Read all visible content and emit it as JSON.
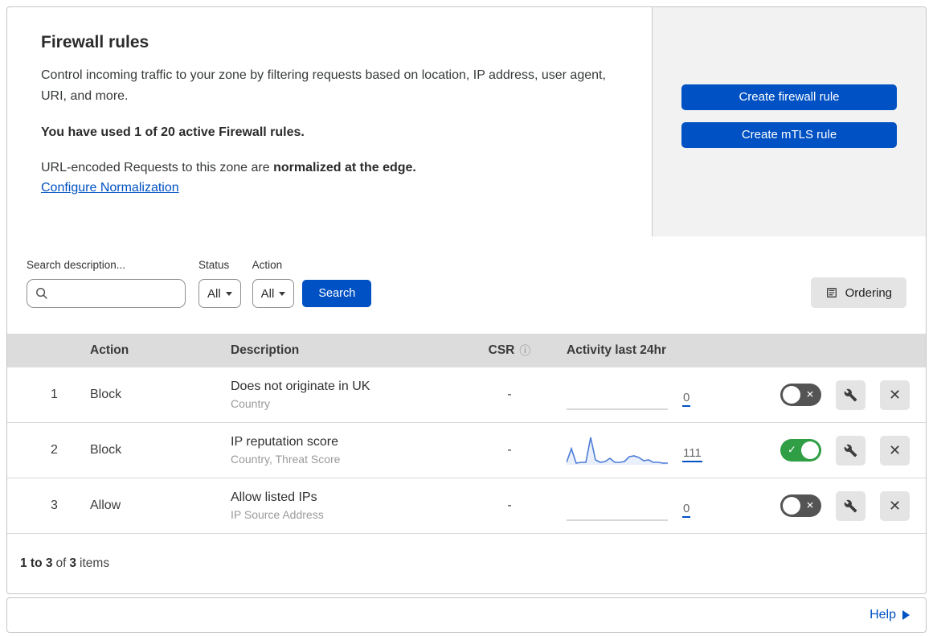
{
  "colors": {
    "primary_blue": "#0051c3",
    "link_blue": "#0051c3",
    "toggle_on": "#2f9e44",
    "toggle_off": "#545454",
    "sparkline_stroke": "#4d7cd6",
    "sparkline_fill": "#e9effb"
  },
  "icons": {
    "info": "ⓘ",
    "check": "✓",
    "cross": "✕",
    "close": "✕"
  },
  "header": {
    "title": "Firewall rules",
    "description": "Control incoming traffic to your zone by filtering requests based on location, IP address, user agent, URI, and more.",
    "usage_bold": "You have used 1 of 20 active Firewall rules.",
    "normalization_prefix": "URL-encoded Requests to this zone are ",
    "normalization_bold": "normalized at the edge.",
    "normalization_link": "Configure Normalization",
    "create_firewall_button": "Create firewall rule",
    "create_mtls_button": "Create mTLS rule"
  },
  "filters": {
    "search_label": "Search description...",
    "status_label": "Status",
    "status_value": "All",
    "action_label": "Action",
    "action_value": "All",
    "search_button": "Search",
    "ordering_button": "Ordering"
  },
  "table": {
    "columns": {
      "action": "Action",
      "description": "Description",
      "csr": "CSR",
      "activity": "Activity last 24hr"
    },
    "rows": [
      {
        "priority": "1",
        "action": "Block",
        "description": "Does not originate in UK",
        "fields": "Country",
        "csr": "-",
        "count": "0",
        "enabled": false,
        "sparkline": []
      },
      {
        "priority": "2",
        "action": "Block",
        "description": "IP reputation score",
        "fields": "Country, Threat Score",
        "csr": "-",
        "count": "111",
        "enabled": true,
        "sparkline": [
          3,
          20,
          2,
          3,
          3,
          34,
          6,
          3,
          4,
          8,
          3,
          3,
          4,
          10,
          11,
          9,
          5,
          6,
          3,
          3,
          2,
          2
        ]
      },
      {
        "priority": "3",
        "action": "Allow",
        "description": "Allow listed IPs",
        "fields": "IP Source Address",
        "csr": "-",
        "count": "0",
        "enabled": false,
        "sparkline": []
      }
    ],
    "summary": {
      "range": "1 to 3",
      "of": "of",
      "total": "3",
      "items": "items"
    }
  },
  "footer": {
    "help_label": "Help"
  }
}
